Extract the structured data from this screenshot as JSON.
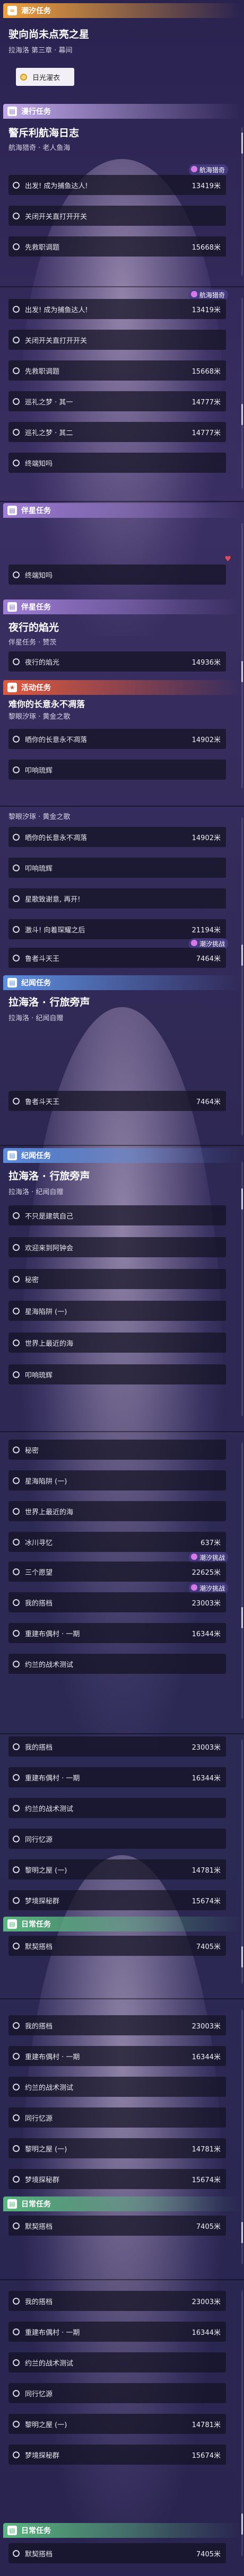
{
  "colors": {
    "tidal": "#f0a13a",
    "travel": "#c0a8ea",
    "companion": "#a07fd6",
    "event": "#e1593c",
    "world": "#5d8fe0",
    "daily": "#5ab77f"
  },
  "icons": {
    "travel": "book-icon",
    "tidal": "wave-icon",
    "heart": "heart-icon",
    "dot": "quest-dot-icon"
  },
  "s1": {
    "cat": "潮汐任务",
    "title": "驶向尚未点亮之星",
    "sub": "拉海洛 第三章 · 幕间",
    "btn": "日光濯衣",
    "cat2": "漫行任务",
    "title2": "警斥利航海日志",
    "sub2": "航海猎奇 · 老人鱼海",
    "tag": "航海猎奇",
    "rows": [
      {
        "l": "出发! 成为捕鱼达人!",
        "d": "13419米"
      },
      {
        "l": "关闭开关直打开开关",
        "d": ""
      },
      {
        "l": "先救职调题",
        "d": "15668米"
      }
    ]
  },
  "s2": {
    "tag": "航海猎奇",
    "rows": [
      {
        "l": "出发! 成为捕鱼达人!",
        "d": "13419米"
      },
      {
        "l": "关闭开关直打开开关",
        "d": ""
      },
      {
        "l": "先救职调题",
        "d": "15668米"
      },
      {
        "l": "巡礼之梦 · 其一",
        "d": "14777米"
      },
      {
        "l": "巡礼之梦 · 其二",
        "d": "14777米"
      },
      {
        "l": "终端知吗",
        "d": ""
      }
    ]
  },
  "s3": {
    "cat": "伴星任务",
    "rowtop": "终端知吗",
    "cat2": "伴星任务",
    "title": "夜行的焰光",
    "sub": "伴星任务 · 赞茨",
    "rows_a": [
      {
        "l": "终端知吗",
        "d": ""
      }
    ],
    "row_b": {
      "l": "夜行的焰光",
      "d": "14936米"
    },
    "cat3": "活动任务",
    "title3": "难你的长意永不凋落",
    "sub3": "黎眼汐琢 · 黄金之歌",
    "rows_c": [
      {
        "l": "晒你的长意永不凋落",
        "d": "14902米"
      },
      {
        "l": "叩响琉辉",
        "d": ""
      }
    ]
  },
  "s4": {
    "sub": "黎眼汐琢 · 黄金之歌",
    "rows": [
      {
        "l": "晒你的长意永不凋落",
        "d": "14902米"
      },
      {
        "l": "叩响琉辉",
        "d": ""
      },
      {
        "l": "星歌致谢意, 再开!",
        "d": ""
      },
      {
        "l": "激斗! 向着琛耀之后",
        "d": "21194米"
      },
      {
        "l": "鲁者斗天王",
        "d": "7464米"
      }
    ],
    "tag": "潮汐挑战",
    "cat": "纪闻任务",
    "title": "拉海洛 · 行旅旁声",
    "sub2": "拉海洛 · 纪闻自赠",
    "row_last": {
      "l": "鲁者斗天王",
      "d": "7464米"
    }
  },
  "s5": {
    "cat": "纪闻任务",
    "title": "拉海洛 · 行旅旁声",
    "sub": "拉海洛 · 纪闻自赠",
    "rows": [
      {
        "l": "不只是建筑自己",
        "d": ""
      },
      {
        "l": "欢迎来到阿钟会",
        "d": ""
      },
      {
        "l": "秘密",
        "d": ""
      },
      {
        "l": "星海陷阱 (一)",
        "d": ""
      },
      {
        "l": "世界上最近的海",
        "d": ""
      },
      {
        "l": "叩响琉辉",
        "d": ""
      }
    ]
  },
  "s6": {
    "rows": [
      {
        "l": "秘密",
        "d": ""
      },
      {
        "l": "星海陷阱 (一)",
        "d": ""
      },
      {
        "l": "世界上最近的海",
        "d": ""
      },
      {
        "l": "冰川寻忆",
        "d": "637米"
      },
      {
        "l": "三个愿望",
        "d": "22625米"
      },
      {
        "l": "我的搭档",
        "d": "23003米"
      },
      {
        "l": "重建布偶村 · 一期",
        "d": "16344米"
      },
      {
        "l": "约兰的战术测试",
        "d": ""
      }
    ],
    "tag1": "潮汐挑战",
    "tag2": "潮汐挑战"
  },
  "s7": {
    "rows": [
      {
        "l": "我的搭档",
        "d": "23003米"
      },
      {
        "l": "重建布偶村 · 一期",
        "d": "16344米"
      },
      {
        "l": "约兰的战术测试",
        "d": ""
      },
      {
        "l": "同行忆源",
        "d": ""
      },
      {
        "l": "黎明之屋 (一)",
        "d": "14781米"
      },
      {
        "l": "梦境探秘群",
        "d": "15674米"
      }
    ],
    "cat": "日常任务",
    "row_last": {
      "l": "默契搭档",
      "d": "7405米"
    }
  },
  "s8": {
    "rows": [
      {
        "l": "我的搭档",
        "d": "23003米"
      },
      {
        "l": "重建布偶村 · 一期",
        "d": "16344米"
      },
      {
        "l": "约兰的战术测试",
        "d": ""
      },
      {
        "l": "同行忆源",
        "d": ""
      },
      {
        "l": "黎明之屋 (一)",
        "d": "14781米"
      },
      {
        "l": "梦境探秘群",
        "d": "15674米"
      }
    ],
    "cat": "日常任务",
    "row_last": {
      "l": "默契搭档",
      "d": "7405米"
    }
  },
  "s9": {
    "rows": [
      {
        "l": "我的搭档",
        "d": "23003米"
      },
      {
        "l": "重建布偶村 · 一期",
        "d": "16344米"
      },
      {
        "l": "约兰的战术测试",
        "d": ""
      },
      {
        "l": "同行忆源",
        "d": ""
      },
      {
        "l": "黎明之屋 (一)",
        "d": "14781米"
      },
      {
        "l": "梦境探秘群",
        "d": "15674米"
      }
    ],
    "cat": "日常任务",
    "row_last": {
      "l": "默契搭档",
      "d": "7405米"
    }
  }
}
